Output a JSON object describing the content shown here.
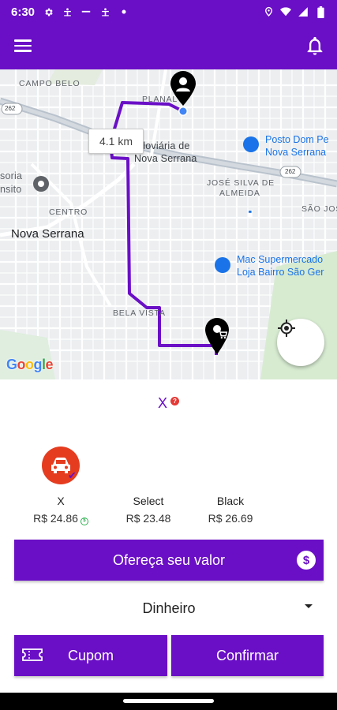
{
  "status_bar": {
    "time": "6:30",
    "left_icons": [
      "gear-icon",
      "accessibility-icon",
      "minus-icon",
      "accessibility-icon",
      "dot-icon"
    ],
    "right_icons": [
      "location-icon",
      "wifi-icon",
      "signal-icon",
      "battery-icon"
    ]
  },
  "app_bar": {
    "menu_icon": "menu-icon",
    "notification_icon": "bell-icon"
  },
  "map": {
    "labels": {
      "campo_belo": "CAMPO BELO",
      "planalto": "PLANAL",
      "rodoviaria_line1": "odoviária de",
      "rodoviaria_line2": "Nova Serrana",
      "posto_line1": "Posto Dom Pe",
      "posto_line2": "Nova Serrana",
      "route_262a": "262",
      "route_262b": "262",
      "soria_line1": "soria",
      "soria_line2": "nsito",
      "jose_silva_line1": "JOSÉ SILVA DE",
      "jose_silva_line2": "ALMEIDA",
      "sao_jos": "SÃO JOS",
      "centro": "CENTRO",
      "nova_serrana": "Nova Serrana",
      "mac_line1": "Mac Supermercado",
      "mac_line2": "Loja Bairro São Ger",
      "bela_vista": "BELA VISTA"
    },
    "route_distance": "4.1 km",
    "google_logo": "Google",
    "origin_marker_icon": "person-pin-icon",
    "destination_marker_icon": "pin-icon",
    "route_color": "#6a0fc6"
  },
  "panel": {
    "service_name": "X",
    "help_badge": "?",
    "selected_vehicle_icon": "car-icon",
    "options": [
      {
        "name": "X",
        "price": "R$ 24.86",
        "selected": true
      },
      {
        "name": "Select",
        "price": "R$ 23.48",
        "selected": false
      },
      {
        "name": "Black",
        "price": "R$ 26.69",
        "selected": false
      }
    ],
    "offer_button_label": "Ofereça seu valor",
    "payment_method": "Dinheiro",
    "coupon_button_label": "Cupom",
    "confirm_button_label": "Confirmar"
  },
  "colors": {
    "brand": "#6a0fc6",
    "vehicle_badge": "#e53c1f"
  }
}
